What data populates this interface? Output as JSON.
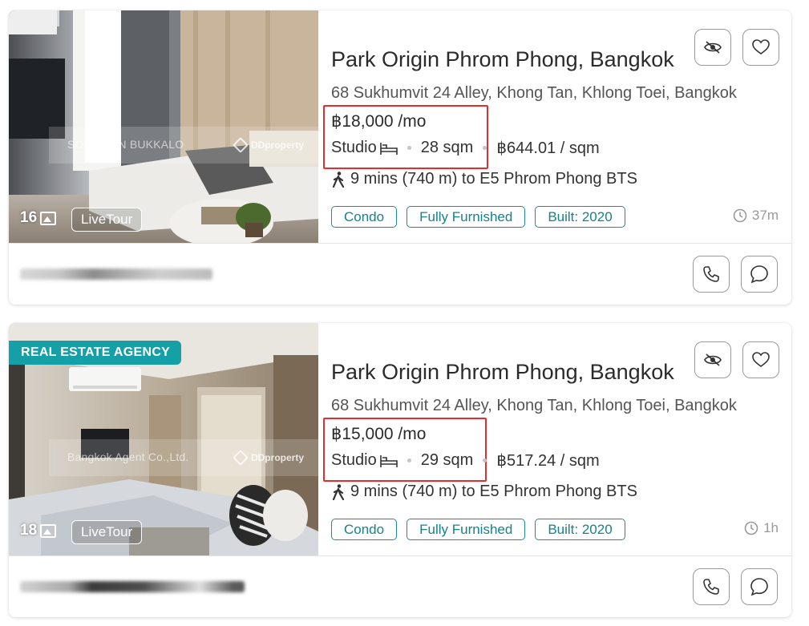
{
  "colors": {
    "accent": "#14a0a6",
    "highlight_box": "#e52d2d",
    "tag_border": "#1a8e93"
  },
  "listings": [
    {
      "photo_count": "16",
      "livetour_label": "LiveTour",
      "watermark_agent": "SOMPORN BUKKALO",
      "watermark_brand": "DDproperty",
      "badge": "",
      "title": "Park Origin Phrom Phong, Bangkok",
      "address": "68 Sukhumvit 24 Alley, Khong Tan, Khlong Toei, Bangkok",
      "price": "฿18,000 /mo",
      "bedrooms": "Studio",
      "bed_icon": "bed-icon",
      "size": "28 sqm",
      "price_per_sqm": "฿644.01 / sqm",
      "transit": "9 mins (740 m) to E5 Phrom Phong BTS",
      "tags": [
        "Condo",
        "Fully Furnished",
        "Built: 2020"
      ],
      "posted_ago": "37m"
    },
    {
      "photo_count": "18",
      "livetour_label": "LiveTour",
      "watermark_agent": "Bangkok Agent Co.,Ltd.",
      "watermark_brand": "DDproperty",
      "badge": "REAL ESTATE AGENCY",
      "title": "Park Origin Phrom Phong, Bangkok",
      "address": "68 Sukhumvit 24 Alley, Khong Tan, Khlong Toei, Bangkok",
      "price": "฿15,000 /mo",
      "bedrooms": "Studio",
      "bed_icon": "bed-icon",
      "size": "29 sqm",
      "price_per_sqm": "฿517.24 / sqm",
      "transit": "9 mins (740 m) to E5 Phrom Phong BTS",
      "tags": [
        "Condo",
        "Fully Furnished",
        "Built: 2020"
      ],
      "posted_ago": "1h"
    }
  ]
}
